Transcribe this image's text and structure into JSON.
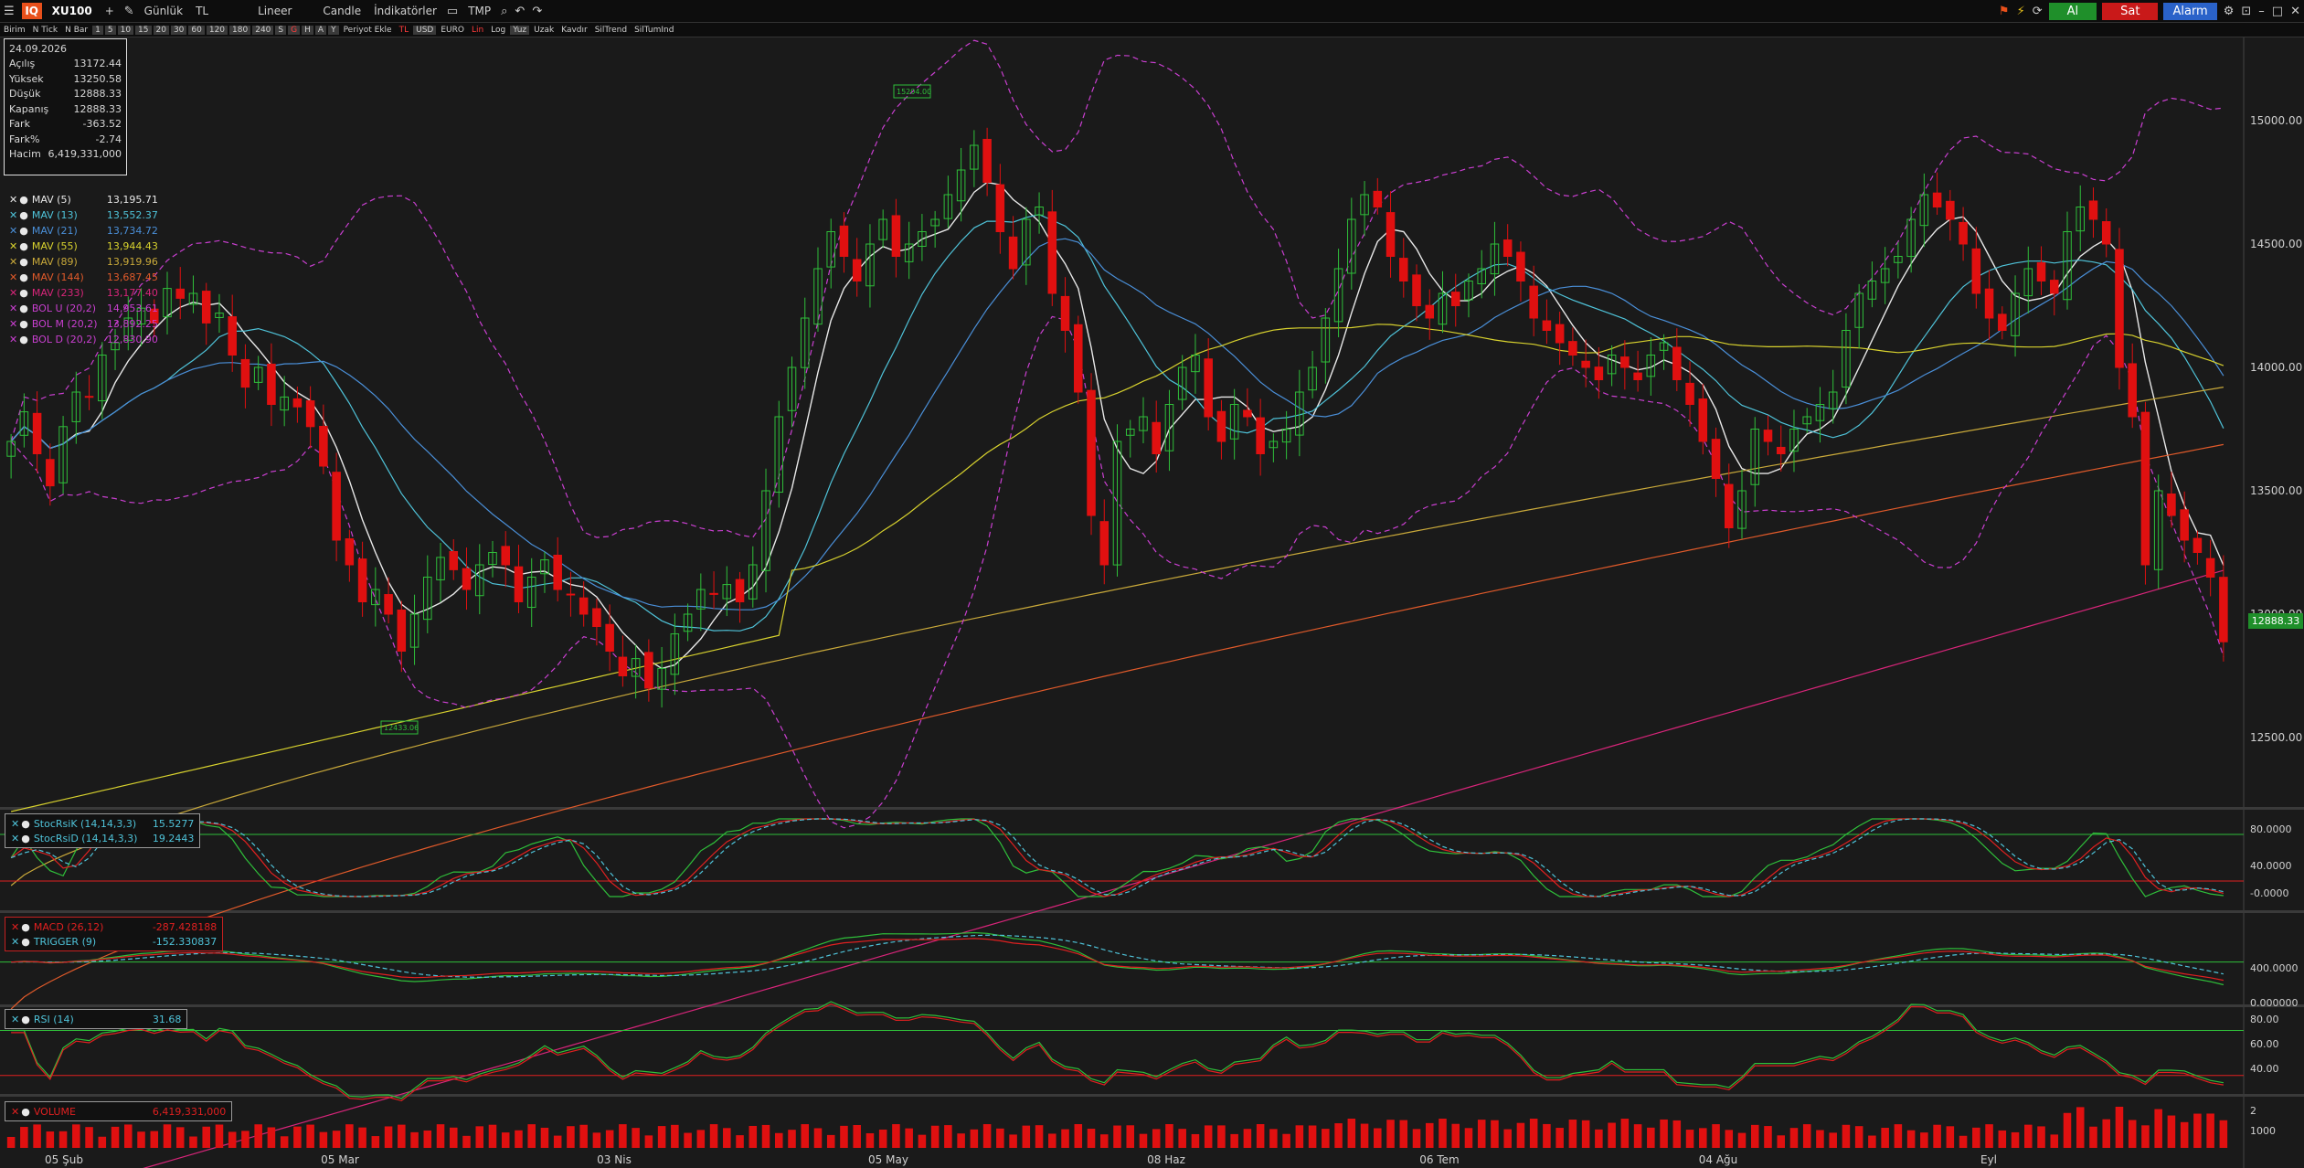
{
  "toolbar": {
    "symbol": "XU100",
    "plus": "+",
    "period": "Günlük",
    "currency": "TL",
    "scale": "Lineer",
    "chart_type": "Candle",
    "indicators": "İndikatörler",
    "template": "TMP",
    "buy": "Al",
    "sell": "Sat",
    "alarm": "Alarm"
  },
  "toolbar2": [
    "Birim",
    "N Tick",
    "N Bar",
    "1",
    "5",
    "10",
    "15",
    "20",
    "30",
    "60",
    "120",
    "180",
    "240",
    "S",
    "G",
    "H",
    "A",
    "Y",
    "Periyot Ekle",
    "TL",
    "USD",
    "EURO",
    "Lin",
    "Log",
    "Yuz",
    "Uzak",
    "Kavdır",
    "SilTrend",
    "SilTumInd"
  ],
  "ohlc": {
    "date": "24.09.2026",
    "rows": [
      {
        "label": "Açılış",
        "value": "13172.44"
      },
      {
        "label": "Yüksek",
        "value": "13250.58"
      },
      {
        "label": "Düşük",
        "value": "12888.33"
      },
      {
        "label": "Kapanış",
        "value": "12888.33"
      },
      {
        "label": "Fark",
        "value": "-363.52"
      },
      {
        "label": "Fark%",
        "value": "-2.74"
      },
      {
        "label": "Hacim",
        "value": "6,419,331,000"
      }
    ]
  },
  "legend": [
    {
      "name": "MAV (5)",
      "value": "13,195.71",
      "color": "#e8e8e8"
    },
    {
      "name": "MAV (13)",
      "value": "13,552.37",
      "color": "#4fc3d9"
    },
    {
      "name": "MAV (21)",
      "value": "13,734.72",
      "color": "#4a8fd8"
    },
    {
      "name": "MAV (55)",
      "value": "13,944.43",
      "color": "#d8d22e"
    },
    {
      "name": "MAV (89)",
      "value": "13,919.96",
      "color": "#c9a93a"
    },
    {
      "name": "MAV (144)",
      "value": "13,687.45",
      "color": "#e05a2a"
    },
    {
      "name": "MAV (233)",
      "value": "13,177.40",
      "color": "#d8257a"
    },
    {
      "name": "BOL U (20,2)",
      "value": "14,953.61",
      "color": "#c93fd0"
    },
    {
      "name": "BOL M (20,2)",
      "value": "13,892.25",
      "color": "#c93fd0"
    },
    {
      "name": "BOL D (20,2)",
      "value": "12,830.90",
      "color": "#c93fd0"
    }
  ],
  "stoch": [
    {
      "name": "StocRsiK (14,14,3,3)",
      "value": "15.5277",
      "color": "#4fc3d9"
    },
    {
      "name": "StocRsiD (14,14,3,3)",
      "value": "19.2443",
      "color": "#4fc3d9"
    }
  ],
  "macd": [
    {
      "name": "MACD (26,12)",
      "value": "-287.428188",
      "color": "#e02020"
    },
    {
      "name": "TRIGGER (9)",
      "value": "-152.330837",
      "color": "#4fc3d9"
    }
  ],
  "rsi": [
    {
      "name": "RSI (14)",
      "value": "31.68",
      "color": "#4fc3d9"
    }
  ],
  "volume": [
    {
      "name": "VOLUME",
      "value": "6,419,331,000",
      "color": "#e02020"
    }
  ],
  "last_price_tag": "12888.33",
  "annotations": {
    "high_label": "15204.00",
    "low_label": "12433.06"
  },
  "axes": {
    "price_ticks": [
      "15000.00",
      "14500.00",
      "14000.00",
      "13500.00",
      "13000.00",
      "12500.00"
    ],
    "stoch_ticks": [
      "80.0000",
      "40.0000",
      "-0.0000"
    ],
    "macd_ticks": [
      "400.0000",
      "0.000000"
    ],
    "rsi_ticks": [
      "80.00",
      "60.00",
      "40.00"
    ],
    "vol_ticks": [
      "2",
      "1000"
    ],
    "date_labels": [
      "05 Şub",
      "05 Mar",
      "03 Nis",
      "05 May",
      "08 Haz",
      "06 Tem",
      "04 Ağu",
      "Eyl"
    ]
  },
  "colors": {
    "up": "#1f8f2a",
    "down": "#e01010",
    "accent": "#e8501b"
  },
  "chart_data": {
    "type": "candlestick",
    "title": "XU100",
    "ylim": [
      12300,
      15300
    ],
    "x_labels": [
      "05 Şub",
      "05 Mar",
      "03 Nis",
      "05 May",
      "08 Haz",
      "06 Tem",
      "04 Ağu",
      "Eyl"
    ],
    "close": [
      13700,
      13820,
      13650,
      13520,
      13760,
      13900,
      13880,
      14050,
      14100,
      14200,
      14240,
      14180,
      14320,
      14280,
      14300,
      14180,
      14220,
      14050,
      13920,
      14000,
      13850,
      13880,
      13840,
      13760,
      13600,
      13300,
      13200,
      13050,
      13100,
      13000,
      12850,
      13000,
      13150,
      13230,
      13180,
      13100,
      13200,
      13250,
      13200,
      13050,
      13150,
      13220,
      13100,
      13080,
      13000,
      12950,
      12850,
      12750,
      12820,
      12700,
      12780,
      12920,
      13000,
      13100,
      13080,
      13120,
      13050,
      13200,
      13500,
      13800,
      14000,
      14200,
      14400,
      14550,
      14450,
      14350,
      14500,
      14600,
      14450,
      14500,
      14550,
      14600,
      14700,
      14800,
      14900,
      14750,
      14550,
      14400,
      14600,
      14650,
      14300,
      14150,
      13900,
      13400,
      13200,
      13700,
      13750,
      13800,
      13650,
      13850,
      14000,
      14050,
      13800,
      13700,
      13850,
      13800,
      13650,
      13700,
      13750,
      13900,
      14000,
      14200,
      14400,
      14600,
      14700,
      14650,
      14450,
      14350,
      14250,
      14200,
      14300,
      14250,
      14350,
      14400,
      14500,
      14450,
      14350,
      14200,
      14150,
      14100,
      14050,
      14000,
      13950,
      14050,
      14000,
      13950,
      14050,
      14100,
      13950,
      13850,
      13700,
      13550,
      13350,
      13500,
      13750,
      13700,
      13650,
      13750,
      13800,
      13850,
      13900,
      14150,
      14300,
      14350,
      14400,
      14450,
      14600,
      14700,
      14650,
      14600,
      14500,
      14300,
      14200,
      14150,
      14300,
      14400,
      14350,
      14300,
      14550,
      14650,
      14600,
      14500,
      14000,
      13800,
      13200,
      13500,
      13400,
      13300,
      13250,
      13150,
      12888
    ],
    "mav5_last": 13195.71,
    "mav13_last": 13552.37,
    "mav21_last": 13734.72,
    "mav55_last": 13944.43,
    "mav89_last": 13919.96,
    "mav144_last": 13687.45,
    "mav233_last": 13177.4,
    "bol_u_last": 14953.61,
    "bol_m_last": 13892.25,
    "bol_d_last": 12830.9,
    "stoch_k_last": 15.5277,
    "stoch_d_last": 19.2443,
    "macd_last": -287.428188,
    "trigger_last": -152.330837,
    "rsi_last": 31.68,
    "volume_last": 6419331000
  }
}
